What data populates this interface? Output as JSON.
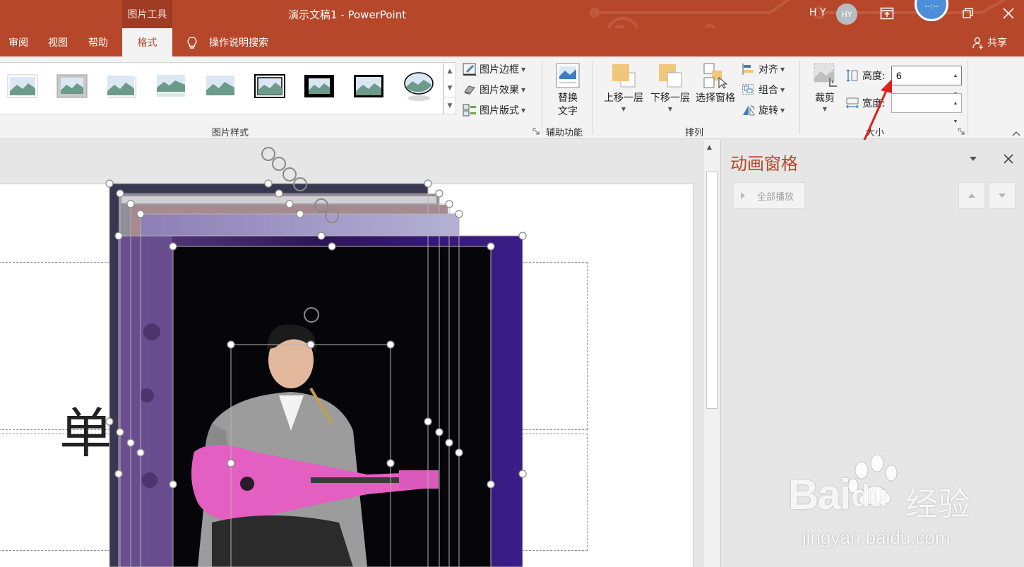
{
  "app": {
    "context_tab_group": "图片工具",
    "document_title": "演示文稿1  -  PowerPoint",
    "user_initials": "H Y",
    "avatar_text": "HY",
    "clock_text": "--:--",
    "accent_color": "#b7472a"
  },
  "tabs": {
    "review": "审阅",
    "view": "视图",
    "help": "帮助",
    "format": "格式",
    "tell_me": "操作说明搜索",
    "share": "共享"
  },
  "ribbon": {
    "picture_styles": {
      "label": "图片样式",
      "border": "图片边框",
      "effects": "图片效果",
      "layout": "图片版式",
      "style_count": 9
    },
    "accessibility": {
      "label": "辅助功能",
      "alt_text_line1": "替换",
      "alt_text_line2": "文字"
    },
    "arrange": {
      "label": "排列",
      "bring_forward": "上移一层",
      "send_backward": "下移一层",
      "selection_pane": "选择窗格",
      "align": "对齐",
      "group": "组合",
      "rotate": "旋转"
    },
    "size": {
      "label": "大小",
      "crop": "裁剪",
      "height_label": "高度:",
      "height_value": "6",
      "width_label": "宽度:",
      "width_value": ""
    }
  },
  "slide": {
    "title_text": "单"
  },
  "animation_pane": {
    "title": "动画窗格",
    "play_all": "全部播放"
  },
  "watermark": {
    "brand": "Bai",
    "brand_suffix": "du",
    "brand_cn": "经验",
    "url": "jingyan.baidu.com"
  }
}
